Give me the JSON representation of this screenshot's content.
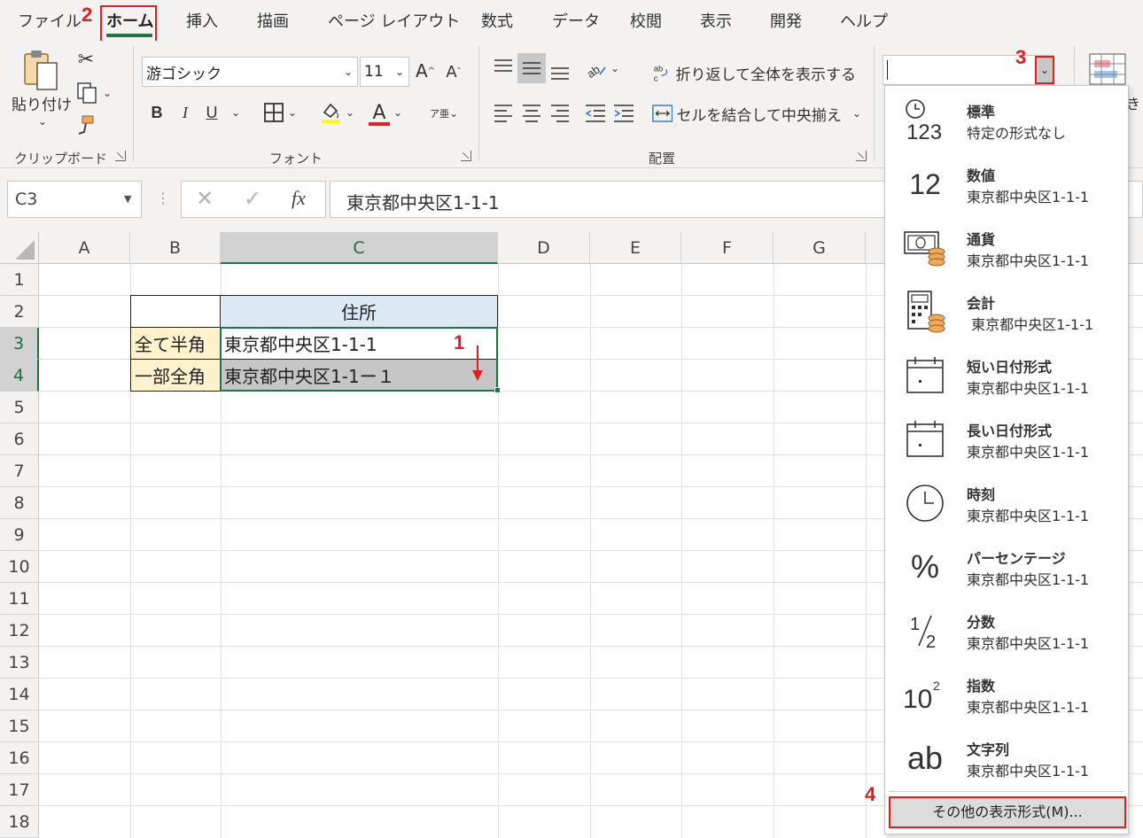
{
  "menu": {
    "tabs": [
      "ファイル",
      "ホーム",
      "挿入",
      "描画",
      "ページ レイアウト",
      "数式",
      "データ",
      "校閲",
      "表示",
      "開発",
      "ヘルプ"
    ]
  },
  "ribbon": {
    "clipboard": {
      "paste_label": "貼り付け",
      "group_label": "クリップボード"
    },
    "font": {
      "font_name": "游ゴシック",
      "font_size": "11",
      "grow_label": "A",
      "shrink_label": "A",
      "bold": "B",
      "italic": "I",
      "underline": "U",
      "font_color": "A",
      "phonetic": "ア亜",
      "group_label": "フォント"
    },
    "alignment": {
      "wrap_text_label": "折り返して全体を表示する",
      "merge_label": "セルを結合して中央揃え",
      "group_label": "配置"
    },
    "number": {
      "format_value": ""
    },
    "cut_off_label": "き"
  },
  "formula_bar": {
    "name_box": "C3",
    "formula": "東京都中央区1-1-1",
    "fx_label": "fx"
  },
  "sheet": {
    "columns": [
      "A",
      "B",
      "C",
      "D",
      "E",
      "F",
      "G"
    ],
    "rows": [
      "1",
      "2",
      "3",
      "4",
      "5",
      "6",
      "7",
      "8",
      "9",
      "10",
      "11",
      "12",
      "13",
      "14",
      "15",
      "16",
      "17",
      "18"
    ],
    "header_c2": "住所",
    "b3": "全て半角",
    "c3": "東京都中央区1-1-1",
    "b4": "一部全角",
    "c4": "東京都中央区1-1ー１"
  },
  "markers": {
    "m1": "1",
    "m2": "2",
    "m3": "3",
    "m4": "4"
  },
  "format_dropdown": {
    "items": [
      {
        "icon": "clock-123-icon",
        "name": "標準",
        "sample": "特定の形式なし"
      },
      {
        "icon": "number-12-icon",
        "name": "数値",
        "sample": "東京都中央区1-1-1"
      },
      {
        "icon": "currency-icon",
        "name": "通貨",
        "sample": "東京都中央区1-1-1"
      },
      {
        "icon": "calculator-icon",
        "name": "会計",
        "sample": " 東京都中央区1-1-1"
      },
      {
        "icon": "calendar-icon",
        "name": "短い日付形式",
        "sample": "東京都中央区1-1-1"
      },
      {
        "icon": "calendar-icon",
        "name": "長い日付形式",
        "sample": "東京都中央区1-1-1"
      },
      {
        "icon": "clock-icon",
        "name": "時刻",
        "sample": "東京都中央区1-1-1"
      },
      {
        "icon": "percent-icon",
        "name": "パーセンテージ",
        "sample": "東京都中央区1-1-1"
      },
      {
        "icon": "fraction-icon",
        "name": "分数",
        "sample": "東京都中央区1-1-1"
      },
      {
        "icon": "exponent-icon",
        "name": "指数",
        "sample": "東京都中央区1-1-1"
      },
      {
        "icon": "text-ab-icon",
        "name": "文字列",
        "sample": "東京都中央区1-1-1"
      }
    ],
    "icon_text": {
      "n123": "123",
      "n12": "12",
      "percent": "%",
      "frac_num": "1",
      "frac_den": "2",
      "exp_base": "10",
      "exp_pow": "2",
      "ab": "ab"
    },
    "more_formats_label": "その他の表示形式(M)..."
  },
  "colors": {
    "accent": "#217346",
    "highlight_red": "#e02020",
    "header_fill": "#dce9f5",
    "label_fill": "#fff2cc",
    "selection_fill": "#c6c6c6"
  }
}
